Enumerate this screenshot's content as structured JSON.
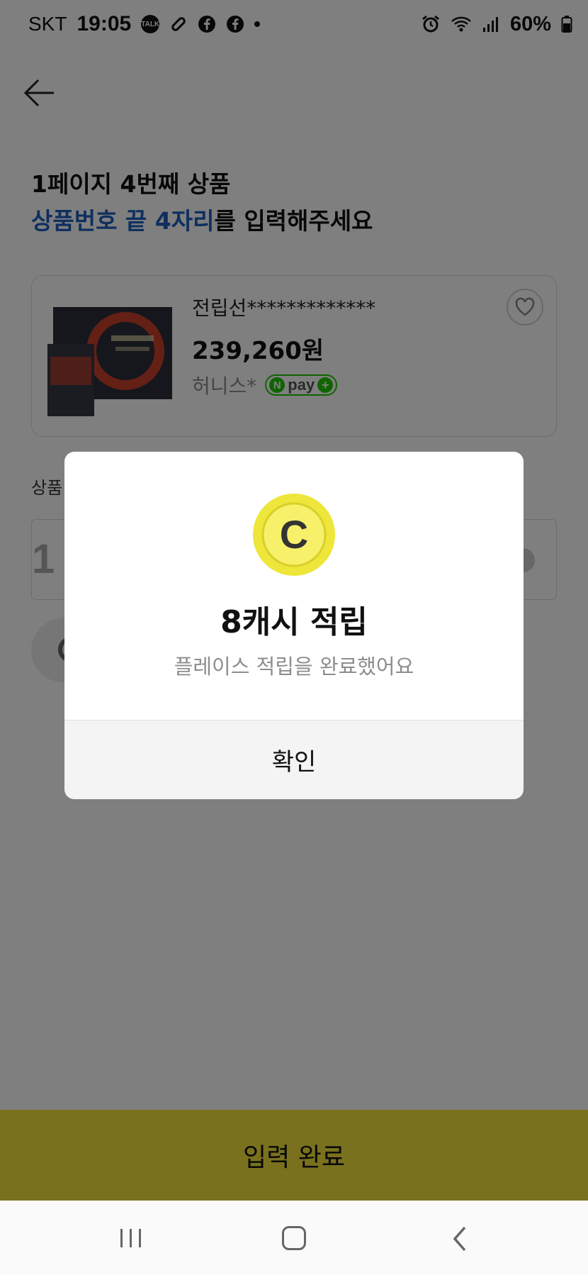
{
  "status_bar": {
    "carrier": "SKT",
    "time": "19:05",
    "notification_icons": [
      "talk-icon",
      "link-icon",
      "facebook-icon",
      "facebook-icon",
      "dot-icon"
    ],
    "talk_label": "TALK",
    "battery": "60%"
  },
  "page": {
    "title_line1": "1페이지 4번째 상품",
    "title_line2_highlight": "상품번호 끝 4자리",
    "title_line2_rest": "를 입력해주세요"
  },
  "product": {
    "name": "전립선*************",
    "price": "239,260원",
    "seller": "허니스*",
    "npay_n": "N",
    "npay_text": "pay"
  },
  "input": {
    "label": "상품",
    "value": "1"
  },
  "dialog": {
    "coin_letter": "C",
    "title": "8캐시 적립",
    "message": "플레이스 적립을 완료했어요",
    "confirm_label": "확인"
  },
  "complete_button": {
    "label": "입력 완료"
  },
  "colors": {
    "highlight_blue": "#1f5fbf",
    "button_yellow": "#f2e33b",
    "npay_green": "#1ec800",
    "coin_yellow": "#f4ea3c"
  }
}
